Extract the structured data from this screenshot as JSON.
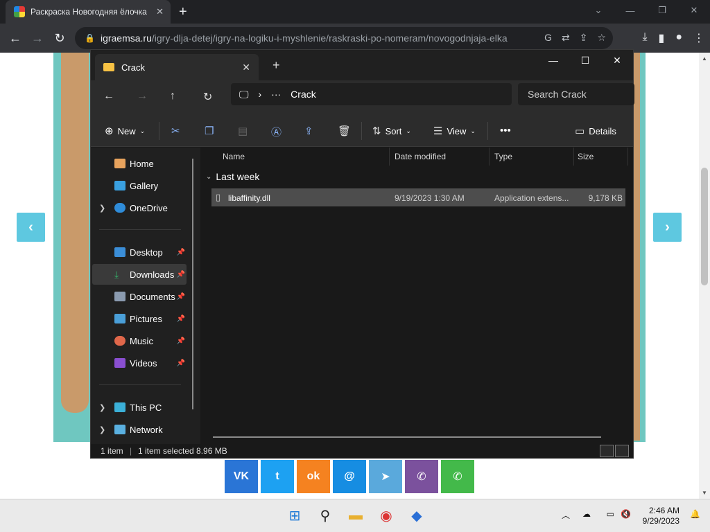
{
  "browser": {
    "tab_title": "Раскраска Новогодняя ёлочка",
    "url_domain": "igraemsa.ru",
    "url_path": "/igry-dlja-detej/igry-na-logiku-i-myshlenie/raskraski-po-nomeram/novogodnjaja-elka"
  },
  "webpage": {
    "prev_arrow": "‹",
    "next_arrow": "›",
    "share_buttons": [
      {
        "name": "vk",
        "label": "VK",
        "color": "#2a75d6"
      },
      {
        "name": "twitter",
        "label": "t",
        "color": "#1da1f2"
      },
      {
        "name": "odnoklassniki",
        "label": "ok",
        "color": "#f58220"
      },
      {
        "name": "moimir",
        "label": "@",
        "color": "#168de2"
      },
      {
        "name": "telegram",
        "label": "➤",
        "color": "#5aa9dc"
      },
      {
        "name": "viber",
        "label": "✆",
        "color": "#7b519d"
      },
      {
        "name": "whatsapp",
        "label": "✆",
        "color": "#43b94a"
      }
    ]
  },
  "explorer": {
    "tab_title": "Crack",
    "breadcrumb_more": "···",
    "breadcrumb_folder": "Crack",
    "search_placeholder": "Search Crack",
    "commands": {
      "new": "New",
      "sort": "Sort",
      "view": "View",
      "details": "Details"
    },
    "nav": {
      "home": "Home",
      "gallery": "Gallery",
      "onedrive": "OneDrive",
      "desktop": "Desktop",
      "downloads": "Downloads",
      "documents": "Documents",
      "pictures": "Pictures",
      "music": "Music",
      "videos": "Videos",
      "this_pc": "This PC",
      "network": "Network"
    },
    "columns": {
      "name": "Name",
      "date": "Date modified",
      "type": "Type",
      "size": "Size"
    },
    "group_label": "Last week",
    "file": {
      "name": "libaffinity.dll",
      "date": "9/19/2023 1:30 AM",
      "type": "Application extens...",
      "size": "9,178 KB"
    },
    "status": {
      "count": "1 item",
      "selected": "1 item selected  8.96 MB"
    }
  },
  "taskbar": {
    "time": "2:46 AM",
    "date": "9/29/2023"
  }
}
